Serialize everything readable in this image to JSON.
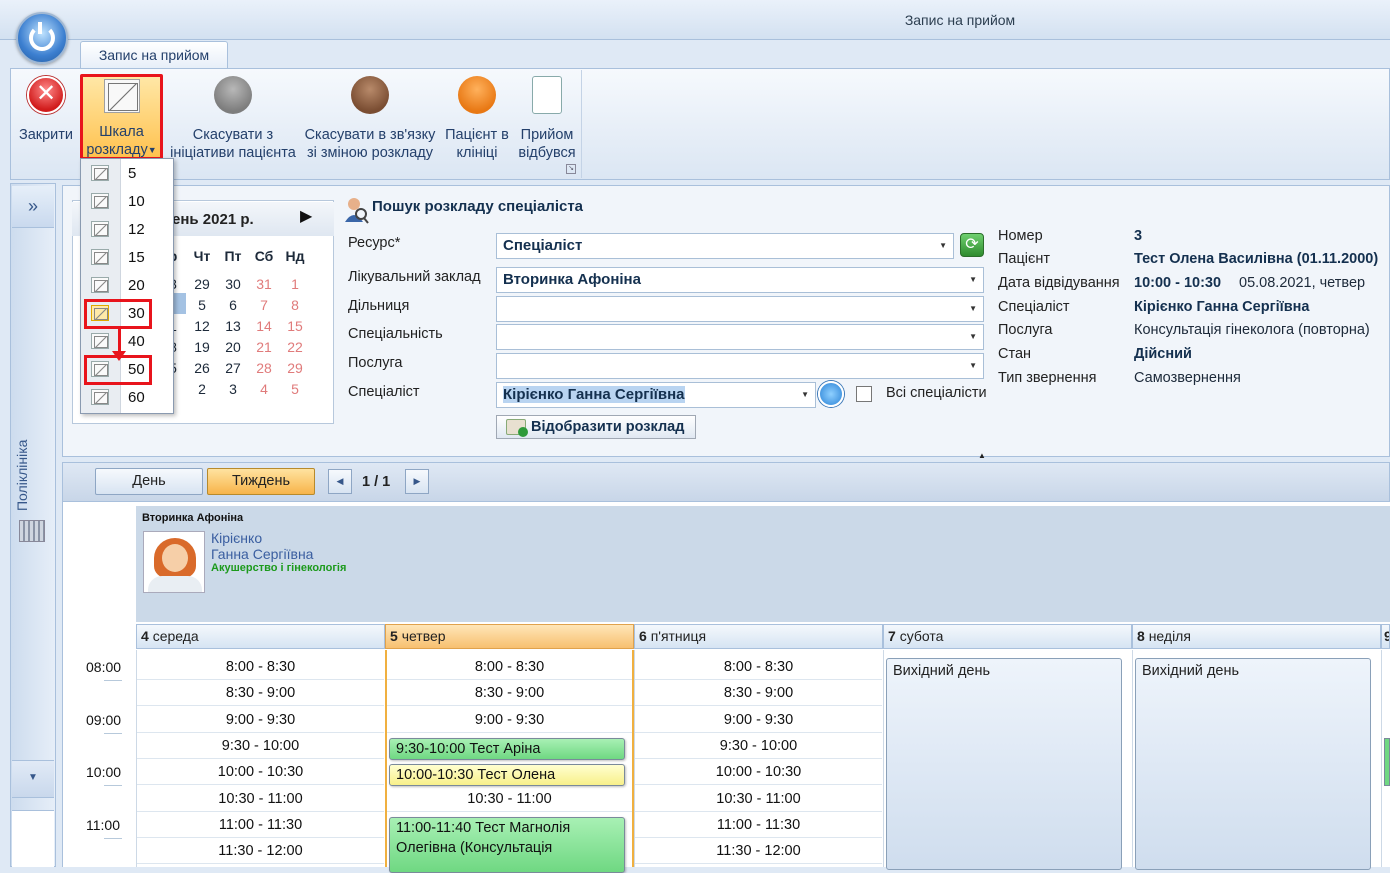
{
  "window": {
    "title": "Запис на прийом"
  },
  "ribbon": {
    "tab": "Запис на прийом",
    "buttons": {
      "close": "Закрити",
      "scale_line1": "Шкала",
      "scale_line2": "розкладу",
      "cancel_patient_line1": "Скасувати з",
      "cancel_patient_line2": "ініціативи пацієнта",
      "cancel_schedule_line1": "Скасувати в зв'язку",
      "cancel_schedule_line2": "зі зміною розкладу",
      "in_clinic_line1": "Пацієнт в",
      "in_clinic_line2": "клініці",
      "done_line1": "Прийом",
      "done_line2": "відбувся"
    }
  },
  "scale_dropdown": {
    "options": [
      "5",
      "10",
      "12",
      "15",
      "20",
      "30",
      "40",
      "50",
      "60"
    ],
    "highlighted_old": "30",
    "highlighted_new": "50"
  },
  "sidebar": {
    "expand": "»",
    "label": "Поліклініка"
  },
  "calendar": {
    "month": "ень 2021 р.",
    "next": "▶",
    "dow": [
      "р",
      "Чт",
      "Пт",
      "Сб",
      "Нд"
    ],
    "rows": [
      [
        "3",
        "29",
        "30",
        "31",
        "1"
      ],
      [
        "",
        "5",
        "6",
        "7",
        "8"
      ],
      [
        "1",
        "12",
        "13",
        "14",
        "15"
      ],
      [
        "8",
        "19",
        "20",
        "21",
        "22"
      ],
      [
        "5",
        "26",
        "27",
        "28",
        "29"
      ],
      [
        "",
        "2",
        "3",
        "4",
        "5"
      ]
    ]
  },
  "search": {
    "title": "Пошук розкладу спеціаліста",
    "fields": {
      "resource_label": "Ресурс*",
      "resource_value": "Спеціаліст",
      "facility_label": "Лікувальний заклад",
      "facility_value": "Вторинка Афоніна",
      "district_label": "Дільниця",
      "specialty_label": "Спеціальність",
      "service_label": "Послуга",
      "specialist_label": "Спеціаліст",
      "specialist_value": "Кірієнко Ганна Сергіївна"
    },
    "all_specialists": "Всі спеціалісти",
    "show_button": "Відобразити розклад"
  },
  "info": {
    "number_label": "Номер",
    "number_value": "3",
    "patient_label": "Пацієнт",
    "patient_value": "Тест Олена Василівна (01.11.2000)",
    "date_label": "Дата відвідування",
    "date_time": "10:00 - 10:30",
    "date_day": "05.08.2021, четвер",
    "specialist_label": "Спеціаліст",
    "specialist_value": "Кірієнко Ганна Сергіївна",
    "service_label": "Послуга",
    "service_value": "Консультація гінеколога (повторна)",
    "state_label": "Стан",
    "state_value": "Дійсний",
    "appeal_label": "Тип звернення",
    "appeal_value": "Самозвернення"
  },
  "schedule": {
    "view_day": "День",
    "view_week": "Тиждень",
    "pager": "1 / 1",
    "doctor": {
      "org": "Вторинка Афоніна",
      "surname": "Кірієнко",
      "name": "Ганна Сергіївна",
      "specialty": "Акушерство і гінекологія"
    },
    "days": [
      {
        "num": "4",
        "name": "середа"
      },
      {
        "num": "5",
        "name": "четвер"
      },
      {
        "num": "6",
        "name": "п'ятниця"
      },
      {
        "num": "7",
        "name": "субота"
      },
      {
        "num": "8",
        "name": "неділя"
      },
      {
        "num": "9",
        "name": ""
      }
    ],
    "hours": [
      "08:00",
      "09:00",
      "10:00",
      "11:00"
    ],
    "slots_wed": [
      "8:00 - 8:30",
      "8:30 - 9:00",
      "9:00 - 9:30",
      "9:30 - 10:00",
      "10:00 - 10:30",
      "10:30 - 11:00",
      "11:00 - 11:30",
      "11:30 - 12:00"
    ],
    "slots_thu": [
      "8:00 - 8:30",
      "8:30 - 9:00",
      "9:00 - 9:30",
      "10:30 - 11:00"
    ],
    "slots_fri": [
      "8:00 - 8:30",
      "8:30 - 9:00",
      "9:00 - 9:30",
      "9:30 - 10:00",
      "10:00 - 10:30",
      "10:30 - 11:00",
      "11:00 - 11:30",
      "11:30 - 12:00"
    ],
    "appointments": {
      "a1": "9:30-10:00 Тест Аріна",
      "a2": "10:00-10:30 Тест Олена",
      "a3_line1": "11:00-11:40 Тест Магнолія",
      "a3_line2": "Олегівна (Консультація"
    },
    "day_off": "Вихідний день"
  }
}
